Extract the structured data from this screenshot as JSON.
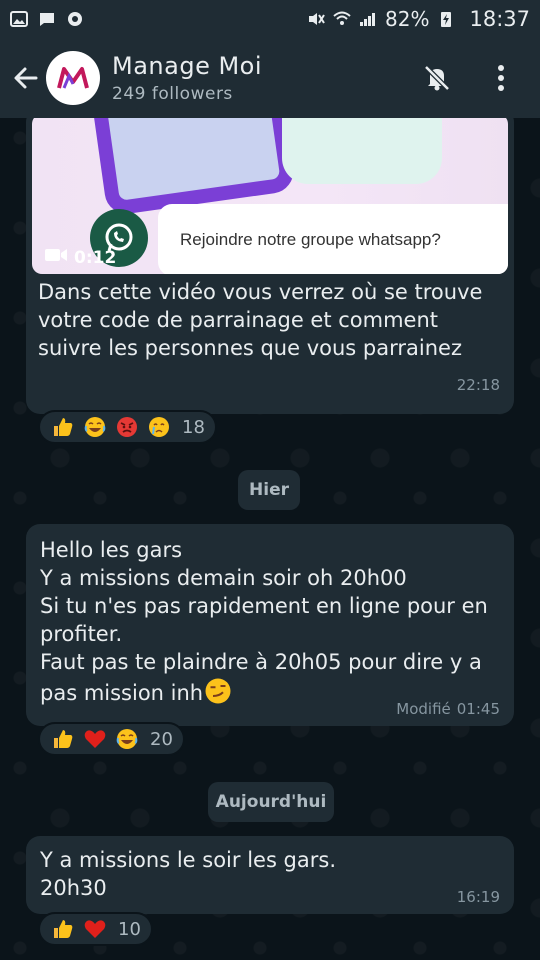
{
  "status_bar": {
    "battery_percent": "82%",
    "time": "18:37"
  },
  "header": {
    "title": "Manage Moi",
    "subtitle": "249 followers",
    "icons": [
      "back-arrow-icon",
      "channel-logo",
      "bell-off-icon",
      "more-vertical-icon"
    ]
  },
  "messages": [
    {
      "media": {
        "caption_text": "Rejoindre notre groupe whatsapp?",
        "duration": "0:12",
        "type": "video"
      },
      "text": "Dans cette vidéo vous verrez où se trouve votre code de parrainage et comment suivre les personnes que vous parrainez",
      "time": "22:18",
      "reactions": {
        "emojis": [
          "thumbs-up",
          "joy",
          "angry",
          "crying"
        ],
        "count": "18"
      }
    },
    {
      "date_chip": "Hier"
    },
    {
      "lines": [
        "Hello les gars",
        "Y a missions demain soir oh 20h00",
        "Si tu n'es pas rapidement en ligne pour en profiter.",
        "Faut pas te plaindre à 20h05 pour dire y a pas mission inh"
      ],
      "edited_label": "Modifié",
      "time": "01:45",
      "reactions": {
        "emojis": [
          "thumbs-up",
          "heart",
          "joy"
        ],
        "count": "20"
      }
    },
    {
      "date_chip": "Aujourd'hui"
    },
    {
      "lines": [
        "Y a missions le soir les gars.",
        "20h30"
      ],
      "time": "16:19",
      "reactions": {
        "emojis": [
          "thumbs-up",
          "heart"
        ],
        "count": "10"
      }
    }
  ],
  "colors": {
    "background": "#0b141a",
    "bubble": "#1f2c34",
    "text": "#e9edef",
    "meta": "#8696a0"
  }
}
